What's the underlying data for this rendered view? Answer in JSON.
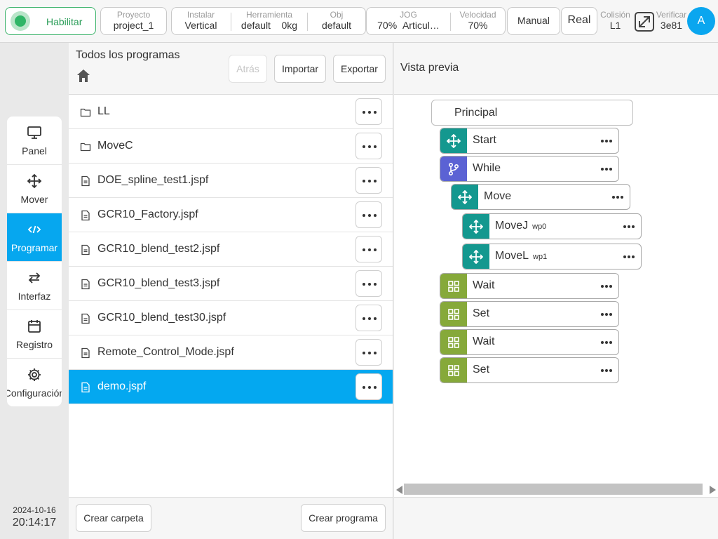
{
  "topbar": {
    "enable_label": "Habilitar",
    "project": {
      "label": "Proyecto",
      "value": "project_1"
    },
    "install": {
      "label": "Instalar",
      "value": "Vertical"
    },
    "tool": {
      "label": "Herramienta",
      "value": "default",
      "value2": "0kg"
    },
    "obj": {
      "label": "Obj",
      "value": "default"
    },
    "jog": {
      "label": "JOG",
      "value": "70%",
      "value2": "Articul…"
    },
    "speed": {
      "label": "Velocidad",
      "value": "70%"
    },
    "mode": "Manual",
    "real": "Real",
    "collision": {
      "label": "Colisión",
      "value": "L1"
    },
    "verify": {
      "label": "Verificar",
      "value": "3e81"
    },
    "avatar": "A",
    "colors": {
      "enable": "#2fb566",
      "accent": "#06a7ef"
    }
  },
  "nav": {
    "items": [
      {
        "label": "Panel",
        "icon": "monitor-icon"
      },
      {
        "label": "Mover",
        "icon": "move-arrows-icon"
      },
      {
        "label": "Programar",
        "icon": "code-icon",
        "active": true
      },
      {
        "label": "Interfaz",
        "icon": "swap-icon"
      },
      {
        "label": "Registro",
        "icon": "calendar-icon"
      },
      {
        "label": "Configuración",
        "icon": "gear-icon"
      }
    ],
    "date": "2024-10-16",
    "time": "20:14:17"
  },
  "list": {
    "title": "Todos los programas",
    "back_label": "Atrás",
    "import_label": "Importar",
    "export_label": "Exportar",
    "items": [
      {
        "name": "LL",
        "type": "folder"
      },
      {
        "name": "MoveC",
        "type": "folder"
      },
      {
        "name": "DOE_spline_test1.jspf",
        "type": "file"
      },
      {
        "name": "GCR10_Factory.jspf",
        "type": "file"
      },
      {
        "name": "GCR10_blend_test2.jspf",
        "type": "file"
      },
      {
        "name": "GCR10_blend_test3.jspf",
        "type": "file"
      },
      {
        "name": "GCR10_blend_test30.jspf",
        "type": "file"
      },
      {
        "name": "Remote_Control_Mode.jspf",
        "type": "file"
      },
      {
        "name": "demo.jspf",
        "type": "file",
        "selected": true
      }
    ],
    "create_folder_label": "Crear carpeta",
    "create_program_label": "Crear programa"
  },
  "preview": {
    "title": "Vista previa",
    "root_label": "Principal",
    "nodes": [
      {
        "label": "Start",
        "sub": "",
        "kind": "move",
        "icon": "move-arrows-icon"
      },
      {
        "label": "While",
        "sub": "",
        "kind": "while",
        "icon": "branch-icon"
      },
      {
        "label": "Move",
        "sub": "",
        "kind": "move",
        "icon": "move-arrows-icon"
      },
      {
        "label": "MoveJ",
        "sub": "wp0",
        "kind": "move",
        "icon": "move-arrows-icon"
      },
      {
        "label": "MoveL",
        "sub": "wp1",
        "kind": "move",
        "icon": "move-arrows-icon"
      },
      {
        "label": "Wait",
        "sub": "",
        "kind": "logic",
        "icon": "grid-icon"
      },
      {
        "label": "Set",
        "sub": "",
        "kind": "logic",
        "icon": "grid-icon"
      },
      {
        "label": "Wait",
        "sub": "",
        "kind": "logic",
        "icon": "grid-icon"
      },
      {
        "label": "Set",
        "sub": "",
        "kind": "logic",
        "icon": "grid-icon"
      }
    ],
    "colors": {
      "move": "#14988f",
      "while": "#5b62d4",
      "logic": "#86a93a"
    }
  }
}
